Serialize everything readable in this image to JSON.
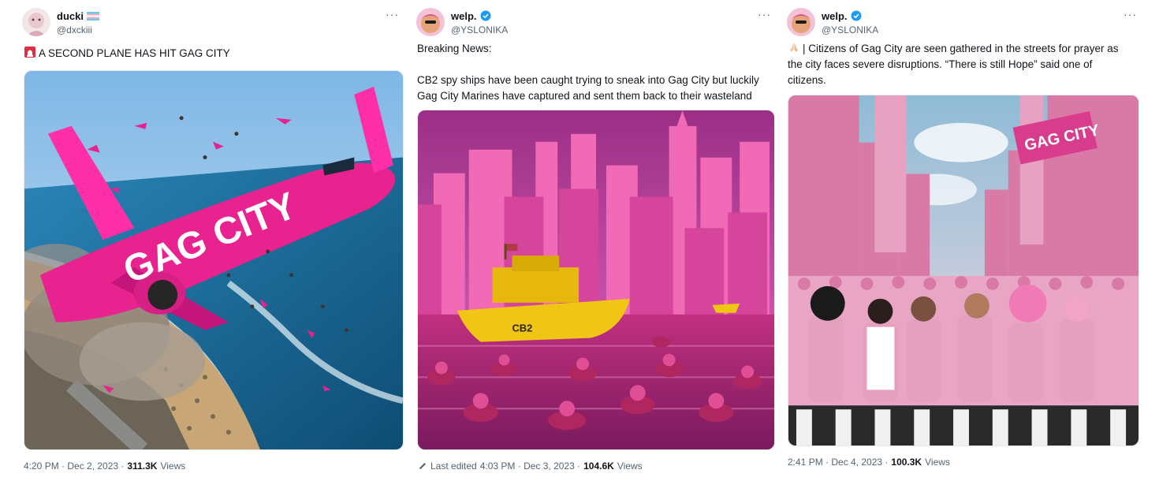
{
  "tweets": [
    {
      "author": {
        "display_name": "ducki",
        "handle": "@dxckiii"
      },
      "text_lines": [
        "A SECOND PLANE HAS HIT GAG CITY"
      ],
      "leading_emoji": "siren-icon",
      "image": {
        "plane_text": "GAG CITY"
      },
      "meta": {
        "edited_label": "",
        "timestamp": "4:20 PM · Dec 2, 2023 · ",
        "views_count": "311.3K",
        "views_label": " Views"
      }
    },
    {
      "author": {
        "display_name": "welp.",
        "handle": "@YSLONIKA"
      },
      "text_lines": [
        "Breaking News:",
        "",
        "CB2 spy ships have been caught trying to sneak into Gag City but luckily",
        "Gag City Marines have captured and sent them back to their wasteland"
      ],
      "image": {
        "boat_text": "CB2"
      },
      "meta": {
        "edited_label": "Last edited ",
        "timestamp": "4:03 PM · Dec 3, 2023 · ",
        "views_count": "104.6K",
        "views_label": " Views"
      }
    },
    {
      "author": {
        "display_name": "welp.",
        "handle": "@YSLONIKA"
      },
      "text_lines": [
        "| Citizens of Gag City are seen gathered in the streets for prayer as",
        "the city faces severe disruptions. “There is still Hope” said one of",
        "citizens."
      ],
      "leading_emoji": "praying-hands-icon",
      "image": {
        "sign_text": "GAG CITY"
      },
      "meta": {
        "edited_label": "",
        "timestamp": "2:41 PM · Dec 4, 2023 · ",
        "views_count": "100.3K",
        "views_label": " Views"
      }
    }
  ],
  "colors": {
    "pink": "#e8228f",
    "hot_pink": "#ff2fa8",
    "sea": "#1f6f9e",
    "text_secondary": "#536471",
    "verified": "#1d9bf0"
  }
}
